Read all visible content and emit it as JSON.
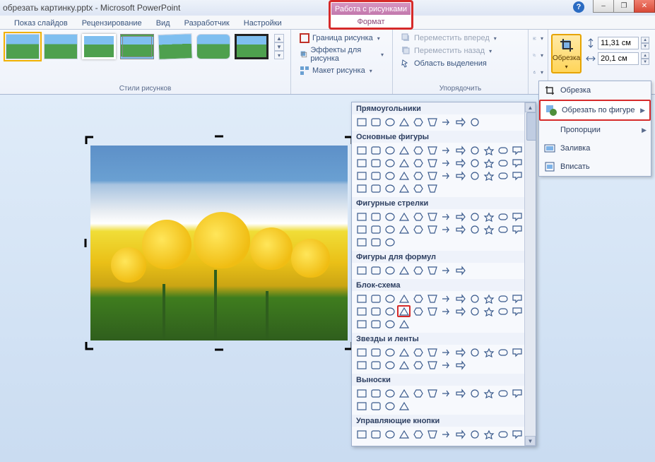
{
  "title": "обрезать картинку.pptx - Microsoft PowerPoint",
  "contextual": {
    "group": "Работа с рисунками",
    "tab": "Формат"
  },
  "tabs": [
    "Показ слайдов",
    "Рецензирование",
    "Вид",
    "Разработчик",
    "Настройки"
  ],
  "ribbon": {
    "styles_label": "Стили рисунков",
    "arrange_label": "Упорядочить",
    "border": "Граница рисунка",
    "effects": "Эффекты для рисунка",
    "layout": "Макет рисунка",
    "bring_forward": "Переместить вперед",
    "send_backward": "Переместить назад",
    "selection_pane": "Область выделения",
    "crop": "Обрезка",
    "height": "11,31 см",
    "width": "20,1 см"
  },
  "crop_menu": {
    "crop": "Обрезка",
    "crop_to_shape": "Обрезать по фигуре",
    "aspect": "Пропорции",
    "fill": "Заливка",
    "fit": "Вписать"
  },
  "shape_cats": {
    "rect": "Прямоугольники",
    "basic": "Основные фигуры",
    "arrows": "Фигурные стрелки",
    "equation": "Фигуры для формул",
    "flowchart": "Блок-схема",
    "stars": "Звезды и ленты",
    "callouts": "Выноски",
    "action": "Управляющие кнопки"
  },
  "icons": {
    "help": "?",
    "min": "–",
    "max": "❐",
    "close": "✕"
  }
}
